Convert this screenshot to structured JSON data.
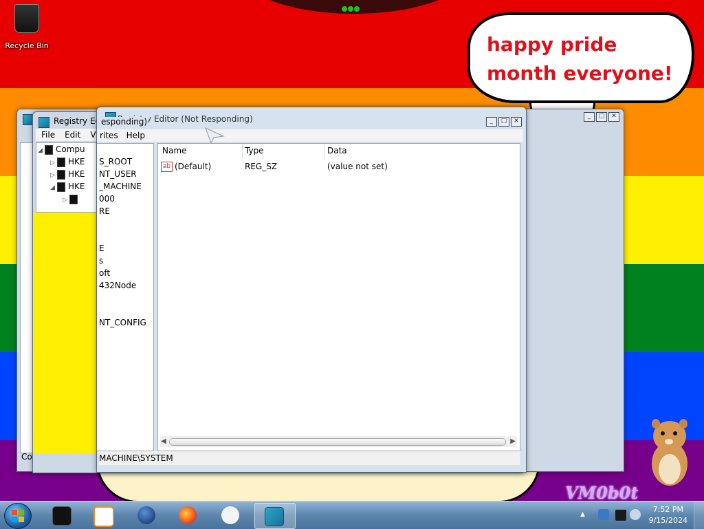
{
  "desktop": {
    "recycle_bin_label": "Recycle Bin",
    "speech_bubble_text": "happy pride month everyone!",
    "brand_text": "VM0b0t"
  },
  "windows": {
    "back": {
      "title": "Registry Edi",
      "tree_partial": [
        "Compu",
        "HKE",
        "HKE",
        "HKE"
      ],
      "status_prefix": "Co"
    },
    "middle": {
      "title": "Registry Edi",
      "title_suffix": "esponding)",
      "menu": [
        "File",
        "Edit",
        "Vi"
      ]
    },
    "front": {
      "title": "Registry Editor (Not Responding)",
      "menu": [
        "rites",
        "Help"
      ],
      "tree": [
        "S_ROOT",
        "NT_USER",
        "_MACHINE",
        "000",
        "RE",
        "E",
        "s",
        "oft",
        "432Node",
        "NT_CONFIG"
      ],
      "columns": {
        "name": "Name",
        "type": "Type",
        "data": "Data"
      },
      "rows": [
        {
          "name": "(Default)",
          "type": "REG_SZ",
          "data": "(value not set)"
        }
      ],
      "status_path": "MACHINE\\SYSTEM"
    }
  },
  "taskbar": {
    "time": "7:52 PM",
    "date": "9/15/2024",
    "apps": [
      "command-prompt",
      "media-player",
      "browser-globe",
      "firefox",
      "paint",
      "registry-editor"
    ],
    "active_app": "registry-editor"
  },
  "colors": {
    "rainbow": [
      "#e70000",
      "#ff8c00",
      "#ffef00",
      "#00811f",
      "#0044ff",
      "#760089"
    ],
    "speech_text": "#e0101a"
  }
}
